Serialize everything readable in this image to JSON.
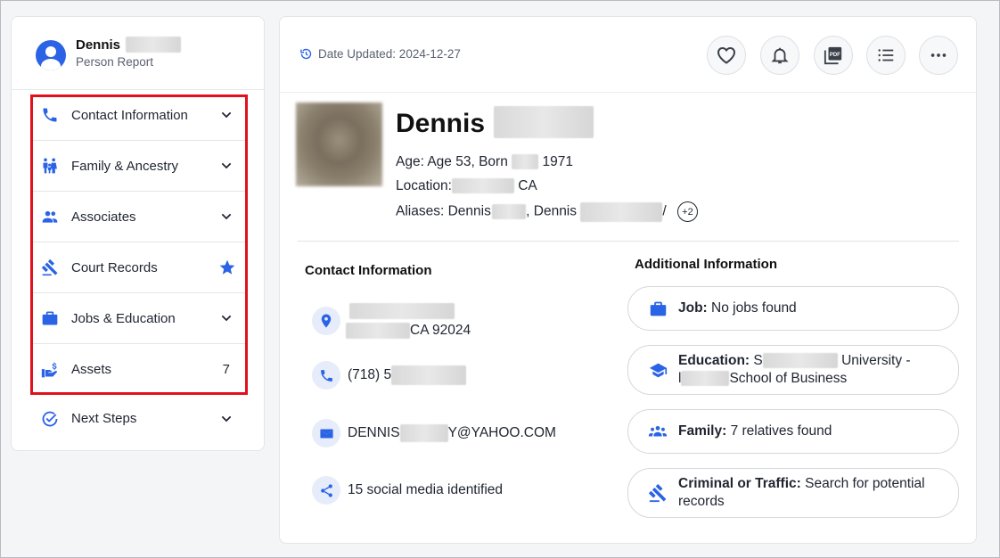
{
  "colors": {
    "accent": "#2a63e6",
    "highlight": "#e0101c"
  },
  "sidebar": {
    "profile_name": "Dennis",
    "profile_subtitle": "Person Report",
    "items": [
      {
        "label": "Contact Information",
        "icon": "phone-icon",
        "right": "chevron-down-icon"
      },
      {
        "label": "Family & Ancestry",
        "icon": "family-icon",
        "right": "chevron-down-icon"
      },
      {
        "label": "Associates",
        "icon": "group-icon",
        "right": "chevron-down-icon"
      },
      {
        "label": "Court Records",
        "icon": "gavel-icon",
        "right": "star-icon"
      },
      {
        "label": "Jobs & Education",
        "icon": "briefcase-icon",
        "right": "chevron-down-icon"
      },
      {
        "label": "Assets",
        "icon": "money-hand-icon",
        "right_text": "7"
      }
    ],
    "next_steps": {
      "label": "Next Steps",
      "icon": "check-circle-icon"
    }
  },
  "header": {
    "date_updated": "Date Updated: 2024-12-27",
    "actions": [
      "heart-icon",
      "bell-icon",
      "pdf-icon",
      "list-icon",
      "more-icon"
    ]
  },
  "person": {
    "first_name": "Dennis",
    "age_line_prefix": "Age: Age 53, Born",
    "age_line_year": "1971",
    "location_prefix": "Location:",
    "location_suffix": "CA",
    "aliases_prefix": "Aliases: Dennis",
    "aliases_mid": ", Dennis",
    "aliases_tail": "/",
    "aliases_more": "+2"
  },
  "contact": {
    "title": "Contact Information",
    "address_line2_suffix": "CA 92024",
    "phone_prefix": "(718)",
    "phone_partial": "5",
    "email_prefix": "DENNIS",
    "email_suffix": "Y@YAHOO.COM",
    "social": "15 social media identified"
  },
  "additional": {
    "title": "Additional Information",
    "job_label": "Job:",
    "job_value": "No jobs found",
    "education_label": "Education:",
    "education_s": "S",
    "education_univ": "University -",
    "education_l": "l",
    "education_school": "School of Business",
    "family_label": "Family:",
    "family_value": "7 relatives found",
    "criminal_label": "Criminal or Traffic:",
    "criminal_value": "Search for potential records"
  }
}
